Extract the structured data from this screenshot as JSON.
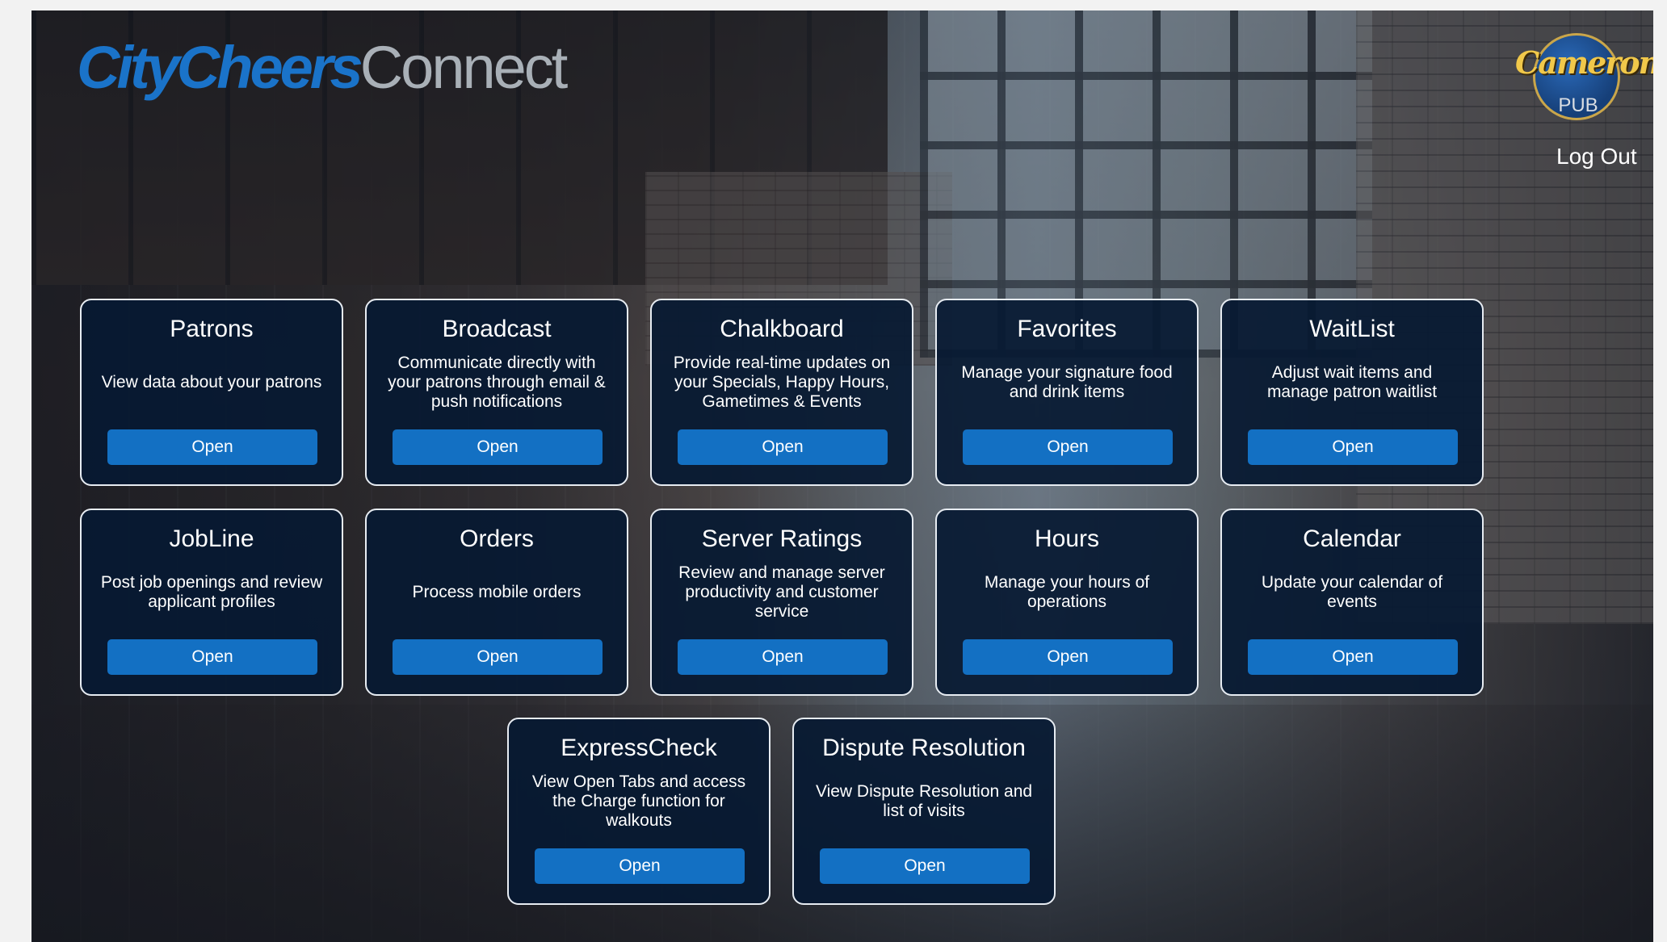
{
  "header": {
    "brand_part1": "CityCheers",
    "brand_part2": "Connect",
    "venue_logo_name": "Cameron's",
    "venue_logo_sub": "PUB",
    "logout_label": "Log Out"
  },
  "cards": [
    {
      "title": "Patrons",
      "description": "View data about your patrons",
      "button": "Open"
    },
    {
      "title": "Broadcast",
      "description": "Communicate directly with your patrons through email & push notifications",
      "button": "Open"
    },
    {
      "title": "Chalkboard",
      "description": "Provide real-time updates on your Specials, Happy Hours, Gametimes & Events",
      "button": "Open"
    },
    {
      "title": "Favorites",
      "description": "Manage your signature food and drink items",
      "button": "Open"
    },
    {
      "title": "WaitList",
      "description": "Adjust wait items and manage patron waitlist",
      "button": "Open"
    },
    {
      "title": "JobLine",
      "description": "Post job openings and review applicant profiles",
      "button": "Open"
    },
    {
      "title": "Orders",
      "description": "Process mobile orders",
      "button": "Open"
    },
    {
      "title": "Server Ratings",
      "description": "Review and manage server productivity and customer service",
      "button": "Open"
    },
    {
      "title": "Hours",
      "description": "Manage your hours of operations",
      "button": "Open"
    },
    {
      "title": "Calendar",
      "description": "Update your calendar of events",
      "button": "Open"
    },
    {
      "title": "ExpressCheck",
      "description": "View Open Tabs and access the Charge function for walkouts",
      "button": "Open"
    },
    {
      "title": "Dispute Resolution",
      "description": "View Dispute Resolution and list of visits",
      "button": "Open"
    }
  ]
}
